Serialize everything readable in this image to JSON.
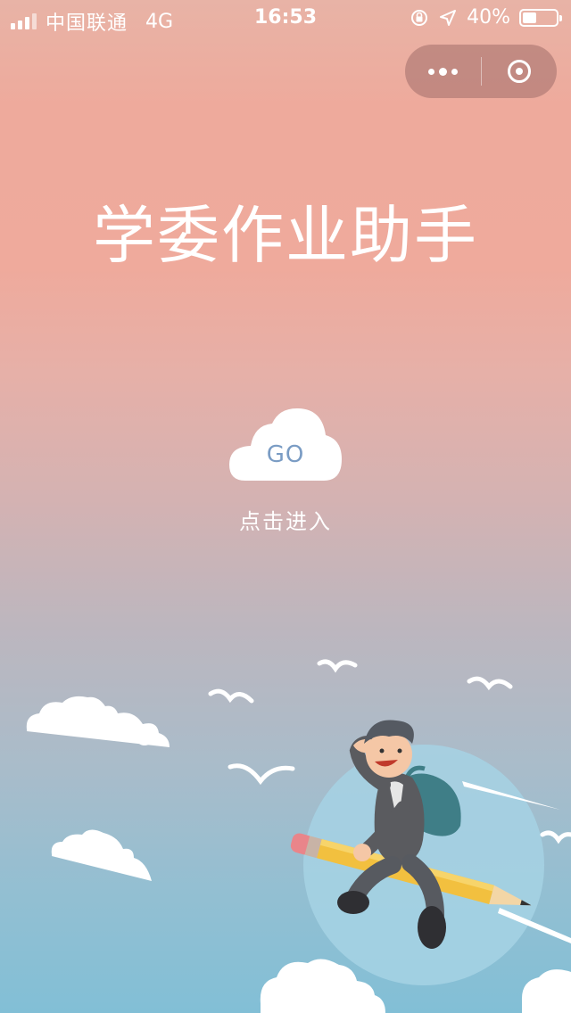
{
  "status_bar": {
    "carrier": "中国联通",
    "network": "4G",
    "time": "16:53",
    "battery": "40%"
  },
  "capsule": {
    "more_icon": "more-dots-icon",
    "close_icon": "close-circle-icon"
  },
  "page": {
    "title": "学委作业助手",
    "go_label": "GO",
    "enter_label": "点击进入"
  },
  "colors": {
    "go_text": "#7a9cc4",
    "bg_top": "#eeaa9c",
    "bg_bottom": "#82bfd6"
  }
}
